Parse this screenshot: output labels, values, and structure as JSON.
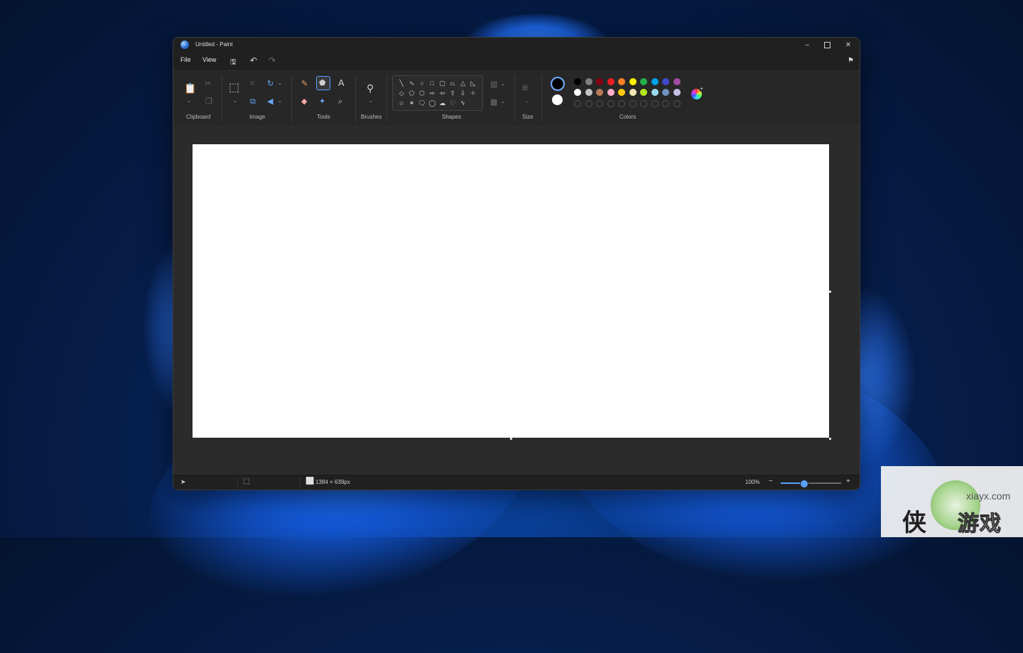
{
  "window": {
    "title": "Untitled - Paint",
    "controls": {
      "minimize": "–",
      "maximize": "",
      "close": "✕"
    }
  },
  "menubar": {
    "file": "File",
    "view": "View",
    "save_icon": "save-icon",
    "undo_icon": "undo-icon",
    "redo_icon": "redo-icon",
    "share_icon": "share-icon"
  },
  "ribbon": {
    "groups": {
      "clipboard": "Clipboard",
      "image": "Image",
      "tools": "Tools",
      "brushes": "Brushes",
      "shapes": "Shapes",
      "size": "Size",
      "colors": "Colors"
    },
    "colors": {
      "primary": "#000000",
      "secondary": "#ffffff",
      "palette_row1": [
        "#000000",
        "#7f7f7f",
        "#880015",
        "#ed1c24",
        "#ff7f27",
        "#fff200",
        "#22b14c",
        "#00a2e8",
        "#3f48cc",
        "#a349a4"
      ],
      "palette_row2": [
        "#ffffff",
        "#c3c3c3",
        "#b97a57",
        "#ffaec9",
        "#ffc90e",
        "#efe4b0",
        "#b5e61d",
        "#99d9ea",
        "#7092be",
        "#c8bfe7"
      ]
    }
  },
  "status": {
    "canvas_size": "1384 × 639px",
    "zoom_label": "100%",
    "zoom_fraction": 0.38
  },
  "watermark": {
    "url": "xiayx.com",
    "cn": "侠",
    "cn2": "游戏"
  }
}
